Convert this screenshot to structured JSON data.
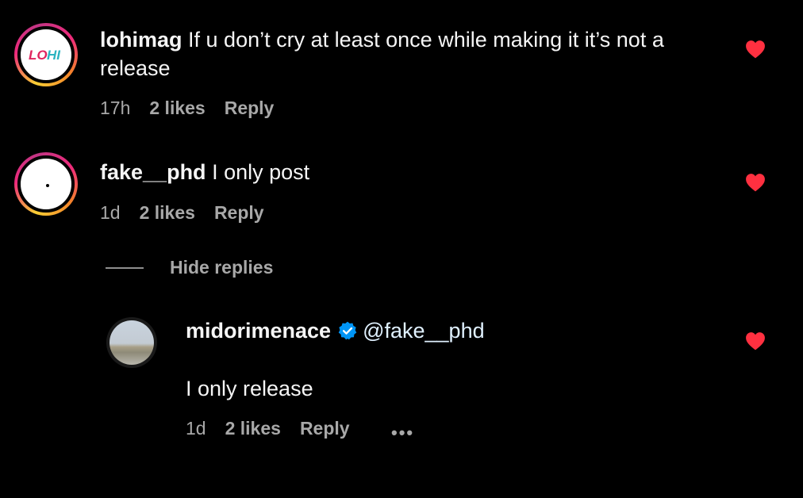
{
  "colors": {
    "background": "#000000",
    "text": "#f5f5f5",
    "muted": "#a8a8a8",
    "heart": "#ff3040",
    "verified": "#0095f6"
  },
  "comments": [
    {
      "username": "lohimag",
      "text_line1": "If u don’t cry at least once while making it it’s not a",
      "text_line2": "release",
      "time": "17h",
      "likes": "2 likes",
      "reply": "Reply",
      "avatar_text": "LOHI",
      "liked": true
    },
    {
      "username": "fake__phd",
      "text_line1": "I only post",
      "time": "1d",
      "likes": "2 likes",
      "reply": "Reply",
      "liked": true
    }
  ],
  "replies_toggle": {
    "label": "Hide replies"
  },
  "reply": {
    "username": "midorimenace",
    "verified": true,
    "mention": "@fake__phd",
    "text": "I only release",
    "time": "1d",
    "likes": "2 likes",
    "reply": "Reply",
    "more": "•••",
    "liked": true
  },
  "icons": {
    "heart": "heart-icon",
    "verified": "verified-badge-icon",
    "more": "more-options-icon"
  }
}
